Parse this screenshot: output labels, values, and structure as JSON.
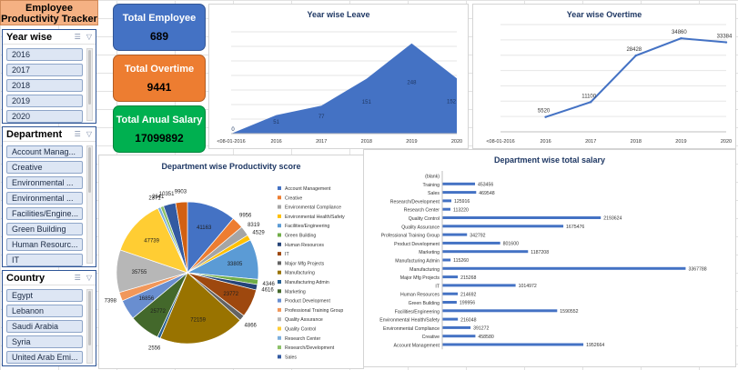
{
  "title": "Employee Productivity Tracker",
  "slicers": {
    "year": {
      "label": "Year wise",
      "items": [
        "2016",
        "2017",
        "2018",
        "2019",
        "2020"
      ]
    },
    "department": {
      "label": "Department",
      "items": [
        "Account Manag...",
        "Creative",
        "Environmental ...",
        "Environmental ...",
        "Facilities/Engine...",
        "Green Building",
        "Human Resourc...",
        "IT"
      ]
    },
    "country": {
      "label": "Country",
      "items": [
        "Egypt",
        "Lebanon",
        "Saudi Arabia",
        "Syria",
        "United Arab Emi..."
      ]
    }
  },
  "kpis": [
    {
      "label": "Total Employee",
      "value": "689",
      "color": "#4472c4"
    },
    {
      "label": "Total Overtime",
      "value": "9441",
      "color": "#ed7d31"
    },
    {
      "label": "Total Anual Salary",
      "value": "17099892",
      "color": "#00b050"
    }
  ],
  "chart_data": [
    {
      "type": "area",
      "title": "Year wise Leave",
      "categories": [
        "<08-01-2016",
        "2016",
        "2017",
        "2018",
        "2019",
        "2020"
      ],
      "values": [
        0,
        51,
        77,
        151,
        248,
        152
      ],
      "ylim": [
        0,
        280
      ],
      "grid": true,
      "color": "#4472c4"
    },
    {
      "type": "line",
      "title": "Year wise Overtime",
      "categories": [
        "<08-01-2016",
        "2016",
        "2017",
        "2018",
        "2019",
        "2020"
      ],
      "values": [
        null,
        5520,
        11100,
        28428,
        34860,
        33384
      ],
      "ylim": [
        0,
        40000
      ],
      "grid": true,
      "color": "#4472c4"
    },
    {
      "type": "pie",
      "title": "Department wise Productivity score",
      "labels": [
        "Account Management",
        "Creative",
        "Environmental Compliance",
        "Environmental Health/Safety",
        "Facilities/Engineering",
        "Green Building",
        "Human Resources",
        "IT",
        "Major Mfg Projects",
        "Manufacturing",
        "Manufacturing Admin",
        "Marketing",
        "Product Development",
        "Professional Training Group",
        "Quality Assurance",
        "Quality Control",
        "Research Center",
        "Research/Development",
        "Sales",
        "Training"
      ],
      "values": [
        41163,
        9956,
        8319,
        4529,
        33805,
        4346,
        4616,
        23772,
        4866,
        72159,
        2556,
        25772,
        16856,
        7398,
        35755,
        47739,
        2371,
        2641,
        10351,
        9903
      ],
      "colors": [
        "#4472c4",
        "#ed7d31",
        "#a5a5a5",
        "#ffc000",
        "#5b9bd5",
        "#70ad47",
        "#264478",
        "#9e480e",
        "#636363",
        "#997300",
        "#255e91",
        "#43682b",
        "#698ed0",
        "#f1975a",
        "#b7b7b7",
        "#ffcd33",
        "#7cafdd",
        "#8cc168",
        "#335aa1",
        "#d26012"
      ],
      "legend": "right"
    },
    {
      "type": "bar",
      "title": "Department wise total salary",
      "categories": [
        "(blank)",
        "Training",
        "Sales",
        "Research/Development",
        "Research Center",
        "Quality Control",
        "Quality Assurance",
        "Professional Training Group",
        "Product Development",
        "Marketing",
        "Manufacturing Admin",
        "Manufacturing",
        "Major Mfg Projects",
        "IT",
        "Human Resources",
        "Green Building",
        "Facilities/Engineering",
        "Environmental Health/Safety",
        "Environmental Compliance",
        "Creative",
        "Account Management"
      ],
      "values": [
        null,
        453456,
        469548,
        125916,
        113220,
        2193624,
        1675476,
        342792,
        801600,
        1187208,
        115260,
        3367788,
        215268,
        1014972,
        214692,
        199956,
        1590552,
        216048,
        391272,
        458580,
        1952664
      ],
      "xlim": [
        0,
        3400000
      ],
      "color": "#4472c4"
    }
  ]
}
